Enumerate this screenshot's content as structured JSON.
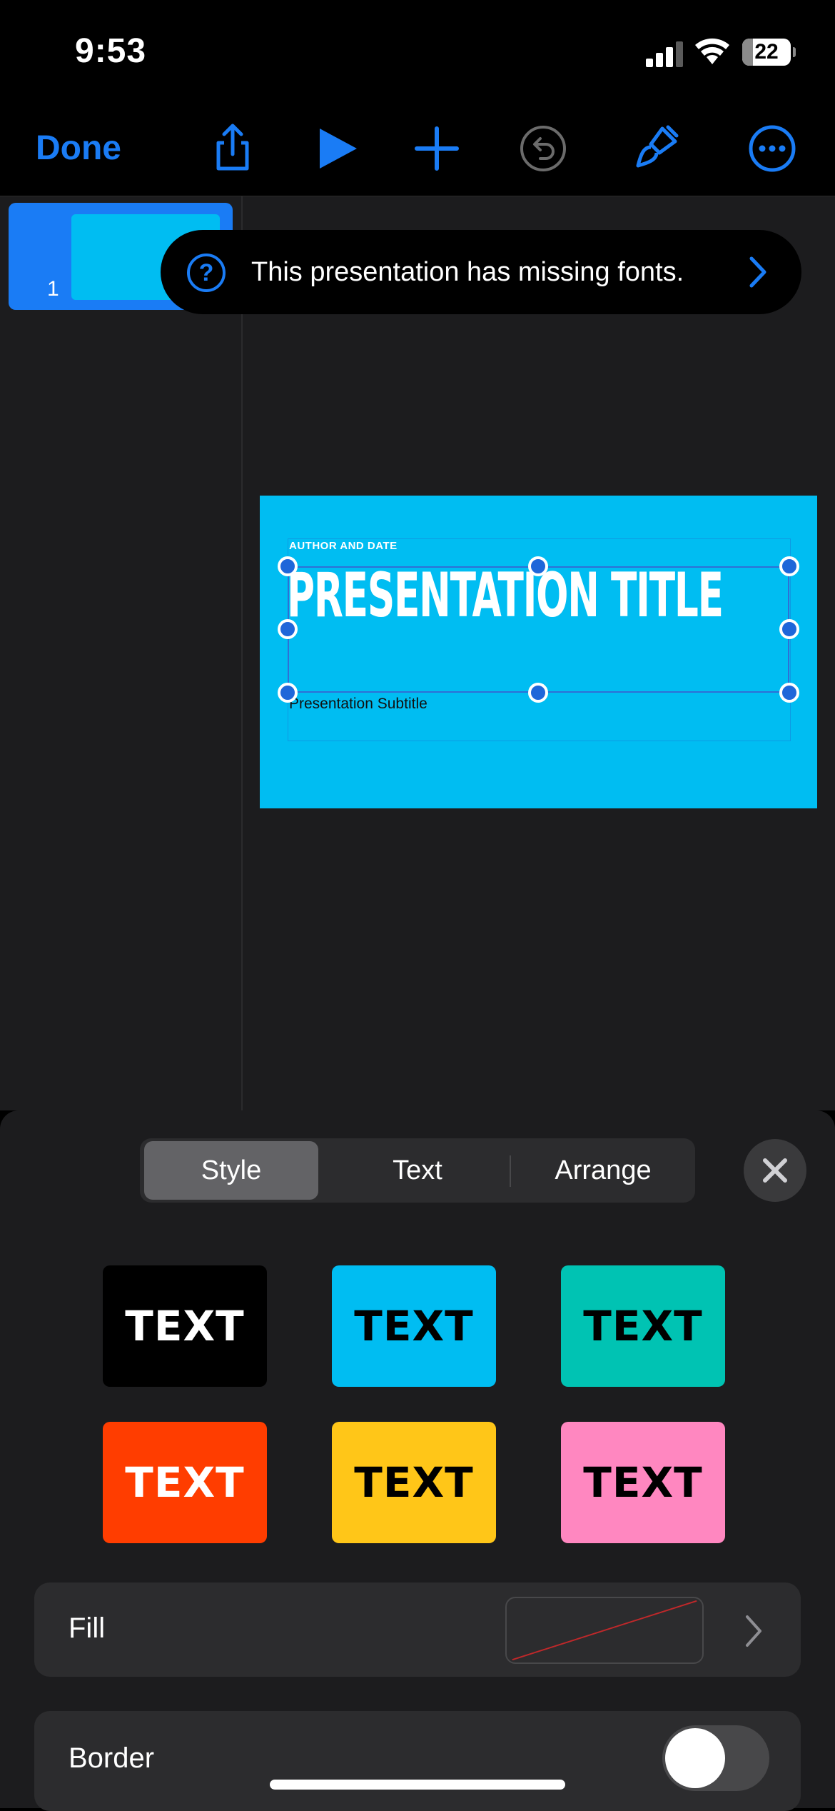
{
  "status_bar": {
    "time": "9:53",
    "battery": "22"
  },
  "toolbar": {
    "done_label": "Done"
  },
  "sidebar": {
    "slides": [
      {
        "number": "1"
      }
    ]
  },
  "banner": {
    "text": "This presentation has missing fonts."
  },
  "slide": {
    "author": "AUTHOR AND DATE",
    "title": "PRESENTATION TITLE",
    "subtitle": "Presentation Subtitle",
    "background": "#00bdf2"
  },
  "panel": {
    "tabs": [
      {
        "label": "Style"
      },
      {
        "label": "Text"
      },
      {
        "label": "Arrange"
      }
    ],
    "active_tab": "Style",
    "text_styles": [
      {
        "label": "TEXT",
        "bg": "#000000",
        "fg": "#ffffff"
      },
      {
        "label": "TEXT",
        "bg": "#00bdf2",
        "fg": "#000000"
      },
      {
        "label": "TEXT",
        "bg": "#00c3b3",
        "fg": "#000000"
      },
      {
        "label": "TEXT",
        "bg": "#ff3d00",
        "fg": "#ffffff"
      },
      {
        "label": "TEXT",
        "bg": "#ffc618",
        "fg": "#000000"
      },
      {
        "label": "TEXT",
        "bg": "#ff87c0",
        "fg": "#000000"
      }
    ],
    "fill_label": "Fill",
    "border_label": "Border",
    "border_enabled": false
  },
  "colors": {
    "accent": "#1a7cf5"
  }
}
